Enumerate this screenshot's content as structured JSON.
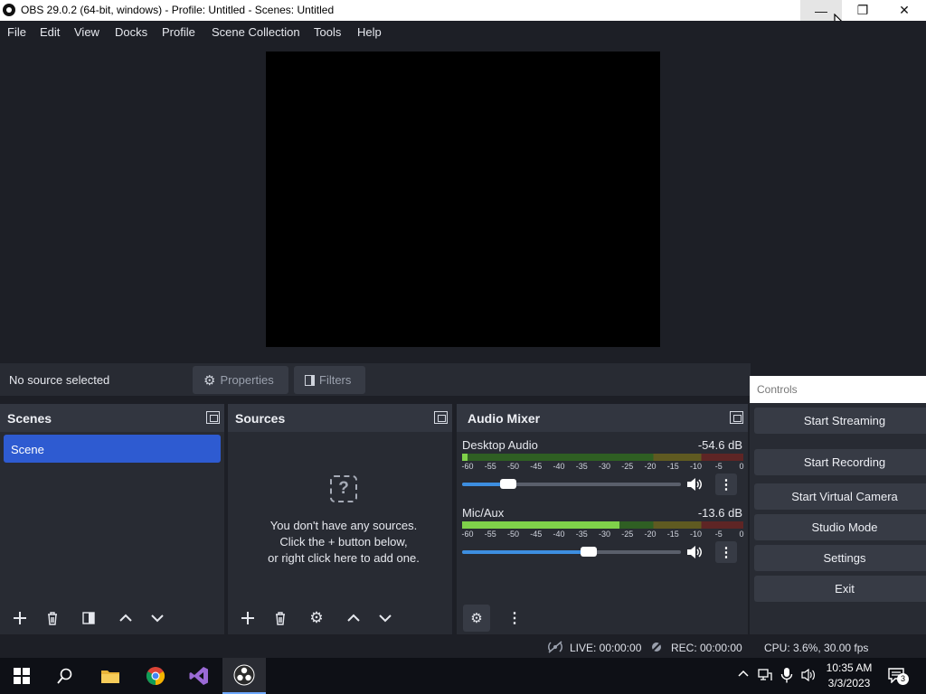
{
  "window": {
    "title": "OBS 29.0.2 (64-bit, windows) - Profile: Untitled - Scenes: Untitled",
    "minimize_symbol": "—",
    "maximize_symbol": "❐",
    "close_symbol": "✕"
  },
  "menu": [
    "File",
    "Edit",
    "View",
    "Docks",
    "Profile",
    "Scene Collection",
    "Tools",
    "Help"
  ],
  "source_toolbar": {
    "status": "No source selected",
    "properties_label": "Properties",
    "filters_label": "Filters"
  },
  "scenes_dock": {
    "title": "Scenes",
    "items": [
      "Scene"
    ]
  },
  "sources_dock": {
    "title": "Sources",
    "empty_line1": "You don't have any sources.",
    "empty_line2": "Click the + button below,",
    "empty_line3": "or right click here to add one."
  },
  "mixer": {
    "title": "Audio Mixer",
    "scale_labels": [
      "-60",
      "-55",
      "-50",
      "-45",
      "-40",
      "-35",
      "-30",
      "-25",
      "-20",
      "-15",
      "-10",
      "-5",
      "0"
    ],
    "channels": [
      {
        "name": "Desktop Audio",
        "db": "-54.6 dB",
        "level": 0.02,
        "volume": 0.21
      },
      {
        "name": "Mic/Aux",
        "db": "-13.6 dB",
        "level": 0.56,
        "volume": 0.58
      }
    ]
  },
  "controls": {
    "title": "Controls",
    "buttons": [
      "Start Streaming",
      "Start Recording",
      "Start Virtual Camera",
      "Studio Mode",
      "Settings",
      "Exit"
    ]
  },
  "statusbar": {
    "live": "LIVE: 00:00:00",
    "rec": "REC: 00:00:00",
    "cpu": "CPU: 3.6%, 30.00 fps"
  },
  "taskbar": {
    "time": "10:35 AM",
    "date": "3/3/2023",
    "notification_count": "3"
  },
  "colors": {
    "background": "#1d1f26",
    "panel": "#282b33",
    "accent": "#2e5bd1",
    "meter_green": "#7fd14a"
  }
}
